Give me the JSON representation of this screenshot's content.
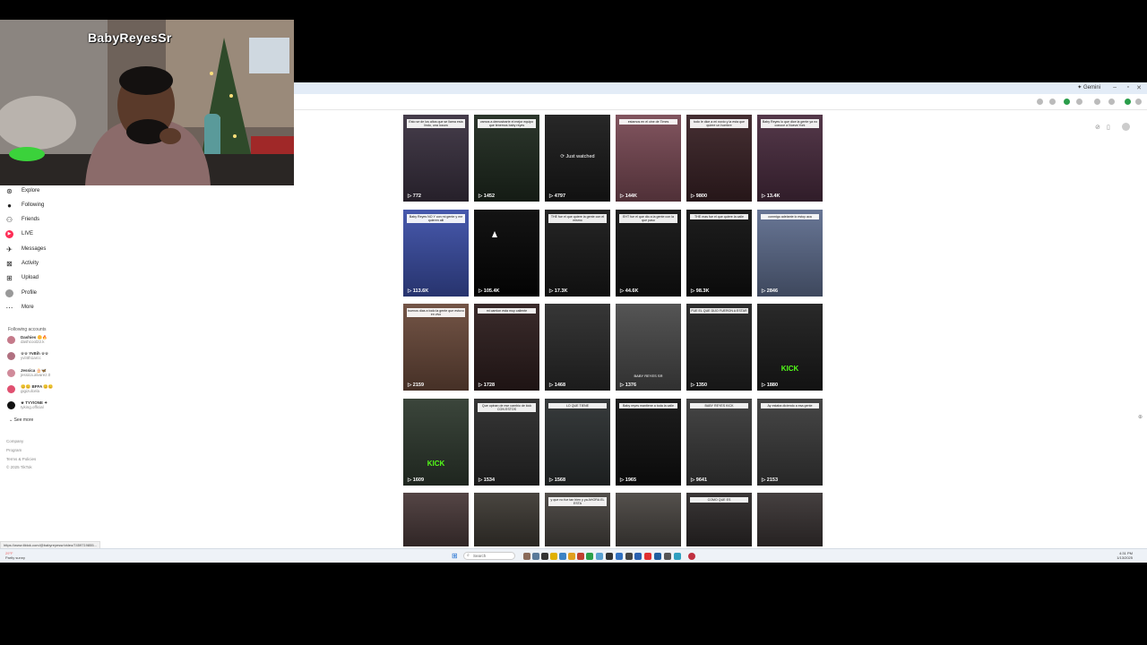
{
  "overlay": {
    "streamer_name": "BabyReyesSr"
  },
  "browser": {
    "tab_label": "✦ Gemini"
  },
  "sidebar": {
    "nav": [
      {
        "label": "Explore",
        "icon": "compass-icon"
      },
      {
        "label": "Following",
        "icon": "following-icon"
      },
      {
        "label": "Friends",
        "icon": "friends-icon"
      },
      {
        "label": "LIVE",
        "icon": "live-icon"
      },
      {
        "label": "Messages",
        "icon": "messages-icon"
      },
      {
        "label": "Activity",
        "icon": "activity-icon"
      },
      {
        "label": "Upload",
        "icon": "upload-icon"
      },
      {
        "label": "Profile",
        "icon": "profile-icon"
      },
      {
        "label": "More",
        "icon": "more-icon"
      }
    ],
    "following_title": "Following accounts",
    "accounts": [
      {
        "name": "Dashies 🌼🔥",
        "handle": "dashcool22.k"
      },
      {
        "name": "☆☆ YvBih ☆☆",
        "handle": "yvl4th1arcc"
      },
      {
        "name": "Jessica 🎂🦋",
        "handle": "jessica.alvarez.0"
      },
      {
        "name": "😊😊 BFFA 😊😊",
        "handle": "gigizulcela"
      },
      {
        "name": "★ TYYIONE ✦",
        "handle": "tyking.official"
      }
    ],
    "see_more": "See more",
    "footer": [
      "Company",
      "Program",
      "Terms & Policies",
      "© 2025 TikTok"
    ]
  },
  "grid": {
    "tiles": [
      {
        "views": "772",
        "caption": "Esto se de los altos que se llama esta lindo, una locura",
        "bg": "#3a3140"
      },
      {
        "views": "1452",
        "caption": "vamos a demostrarte el mejor equipo que tenemos baby reyes",
        "bg": "#1f2a1f"
      },
      {
        "views": "4797",
        "caption": "",
        "bg": "#1a1a1a",
        "overlay": "⟳ Just watched"
      },
      {
        "views": "144K",
        "caption": "estamos en el cine de Times",
        "bg": "#7a4a55"
      },
      {
        "views": "9800",
        "caption": "todo le dice a mi novio y la esta que quiere un hombre",
        "bg": "#3a2226"
      },
      {
        "views": "13.4K",
        "caption": "Baby Reyes lo que dice la gente ya no conoce a Nueva York",
        "bg": "#4a2c3f"
      },
      {
        "views": "113.6K",
        "caption": "Baby Reyes NO Y con mi gente y me quieren allí",
        "bg": "#3c4fa8"
      },
      {
        "views": "105.4K",
        "caption": "",
        "bg": "#050505"
      },
      {
        "views": "17.3K",
        "caption": "THE fue el que quiere la gente con el mismo",
        "bg": "#181818"
      },
      {
        "views": "44.6K",
        "caption": "EHT fue el que dio a la gente con la que paso",
        "bg": "#121212"
      },
      {
        "views": "98.3K",
        "caption": "THE mas fue el que quiere la calle",
        "bg": "#101010"
      },
      {
        "views": "2846",
        "caption": "conmigo adelante lo estoy aca",
        "bg": "#5f6e8f"
      },
      {
        "views": "2159",
        "caption": "buenos dias a todo la gente que estuvo en vivo",
        "bg": "#6b4a3b"
      },
      {
        "views": "1728",
        "caption": "mi camion esta muy caliente",
        "bg": "#2e1e1e"
      },
      {
        "views": "1468",
        "caption": "",
        "bg": "#2a2a2a"
      },
      {
        "views": "1376",
        "caption": "",
        "bg": "#4a4a4a",
        "label": "BABY REYES SR"
      },
      {
        "views": "1350",
        "caption": "FUE EL QUE DIJO FUERON A ESTAR",
        "bg": "#222"
      },
      {
        "views": "1880",
        "caption": "",
        "bg": "#1c1c1c",
        "kick": "KICK"
      },
      {
        "views": "1609",
        "caption": "",
        "bg": "#2f3a2f",
        "kick": "KICK"
      },
      {
        "views": "1534",
        "caption": "Que opinan de ese cambio de kick CON ESTOS",
        "bg": "#2a2a2a"
      },
      {
        "views": "1568",
        "caption": "LO QUE TIENE",
        "bg": "#2b2f30"
      },
      {
        "views": "1965",
        "caption": "Baby reyes mantiene a toda la calle",
        "bg": "#101010"
      },
      {
        "views": "9641",
        "caption": "BABY REYES KICK",
        "bg": "#3a3a3a"
      },
      {
        "views": "2153",
        "caption": "Ay estaba diciendo a esa gente",
        "bg": "#3b3b3b"
      },
      {
        "views": "",
        "caption": "",
        "bg": "#4a3a3a"
      },
      {
        "views": "",
        "caption": "",
        "bg": "#3e3a34"
      },
      {
        "views": "",
        "caption": "y que no fue tan bien y ya AHORA EL ESTA",
        "bg": "#484440"
      },
      {
        "views": "",
        "caption": "",
        "bg": "#4a4642"
      },
      {
        "views": "",
        "caption": "COMO QUE ES",
        "bg": "#2e2a2a"
      },
      {
        "views": "",
        "caption": "",
        "bg": "#3a3434"
      }
    ]
  },
  "statusbar": {
    "url": "https://www.tiktok.com/@babyreyessr/video/7459719855..."
  },
  "taskbar": {
    "weather_temp": "29°F",
    "weather_desc": "Partly sunny",
    "search_placeholder": "Search",
    "time": "4:31 PM",
    "date": "1/13/2025"
  }
}
